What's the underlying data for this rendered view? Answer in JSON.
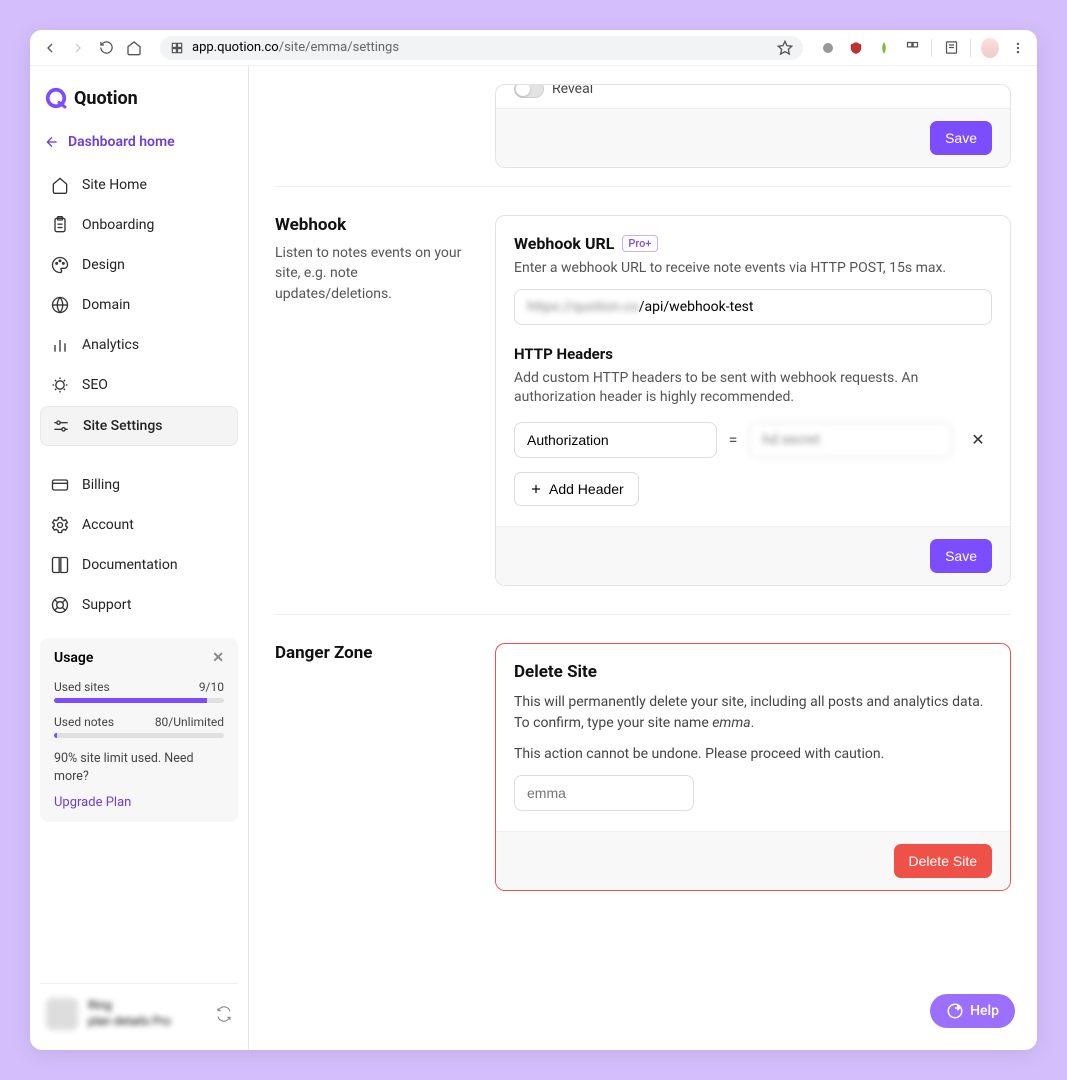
{
  "browser": {
    "url_domain": "app.quotion.co",
    "url_path": "/site/emma/settings"
  },
  "logo": {
    "text": "Quotion"
  },
  "dashboard_link": "Dashboard home",
  "nav": {
    "site_home": "Site Home",
    "onboarding": "Onboarding",
    "design": "Design",
    "domain": "Domain",
    "analytics": "Analytics",
    "seo": "SEO",
    "site_settings": "Site Settings",
    "billing": "Billing",
    "account": "Account",
    "documentation": "Documentation",
    "support": "Support"
  },
  "usage": {
    "title": "Usage",
    "sites_label": "Used sites",
    "sites_value": "9/10",
    "sites_pct": 90,
    "notes_label": "Used notes",
    "notes_value": "80/Unlimited",
    "notes_pct": 2,
    "message": "90% site limit used. Need more?",
    "upgrade": "Upgrade Plan"
  },
  "user": {
    "name": "Ring",
    "subtitle": "plan details Pro"
  },
  "reveal": {
    "label": "Reveal"
  },
  "save_label": "Save",
  "webhook": {
    "section_title": "Webhook",
    "section_desc": "Listen to notes events on your site, e.g. note updates/deletions.",
    "url_label": "Webhook URL",
    "pro_badge": "Pro+",
    "url_desc": "Enter a webhook URL to receive note events via HTTP POST, 15s max.",
    "url_value_prefix": "https://quotion.co",
    "url_value_suffix": "/api/webhook-test",
    "headers_label": "HTTP Headers",
    "headers_desc": "Add custom HTTP headers to be sent with webhook requests. An authorization header is highly recommended.",
    "header_key": "Authorization",
    "header_value": "hd secret",
    "add_header": "Add Header"
  },
  "danger": {
    "section_title": "Danger Zone",
    "delete_title": "Delete Site",
    "delete_text_1": "This will permanently delete your site, including all posts and analytics data. To confirm, type your site name ",
    "delete_text_sitename": "emma",
    "delete_text_2": "This action cannot be undone. Please proceed with caution.",
    "placeholder": "emma",
    "delete_btn": "Delete Site"
  },
  "help_label": "Help"
}
